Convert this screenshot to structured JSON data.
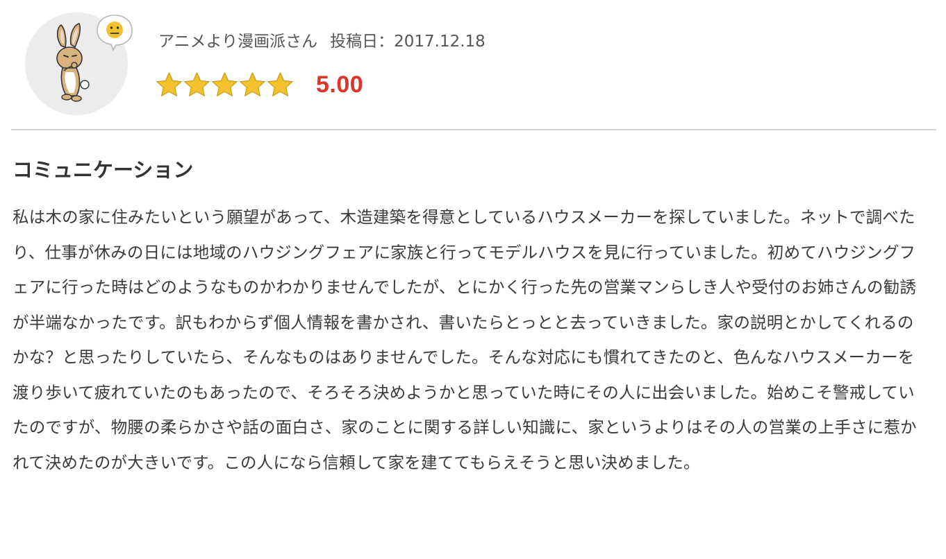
{
  "review": {
    "author": "アニメより漫画派さん",
    "date_label": "投稿日：2017.12.18",
    "score": "5.00",
    "star_count": 5,
    "stars_filled": 5,
    "avatar_icon": "rabbit-thinking-icon",
    "mood_icon": "neutral-face-icon",
    "colors": {
      "star": "#f2c12e",
      "score": "#e0332a",
      "divider": "#cfcfcf",
      "avatar_bg": "#ececec"
    }
  },
  "section": {
    "title": "コミュニケーション",
    "body": "私は木の家に住みたいという願望があって、木造建築を得意としているハウスメーカーを探していました。ネットで調べたり、仕事が休みの日には地域のハウジングフェアに家族と行ってモデルハウスを見に行っていました。初めてハウジングフェアに行った時はどのようなものかわかりませんでしたが、とにかく行った先の営業マンらしき人や受付のお姉さんの勧誘が半端なかったです。訳もわからず個人情報を書かされ、書いたらとっとと去っていきました。家の説明とかしてくれるのかな？と思ったりしていたら、そんなものはありませんでした。そんな対応にも慣れてきたのと、色んなハウスメーカーを渡り歩いて疲れていたのもあったので、そろそろ決めようかと思っていた時にその人に出会いました。始めこそ警戒していたのですが、物腰の柔らかさや話の面白さ、家のことに関する詳しい知識に、家というよりはその人の営業の上手さに惹かれて決めたのが大きいです。この人になら信頼して家を建ててもらえそうと思い決めました。"
  }
}
